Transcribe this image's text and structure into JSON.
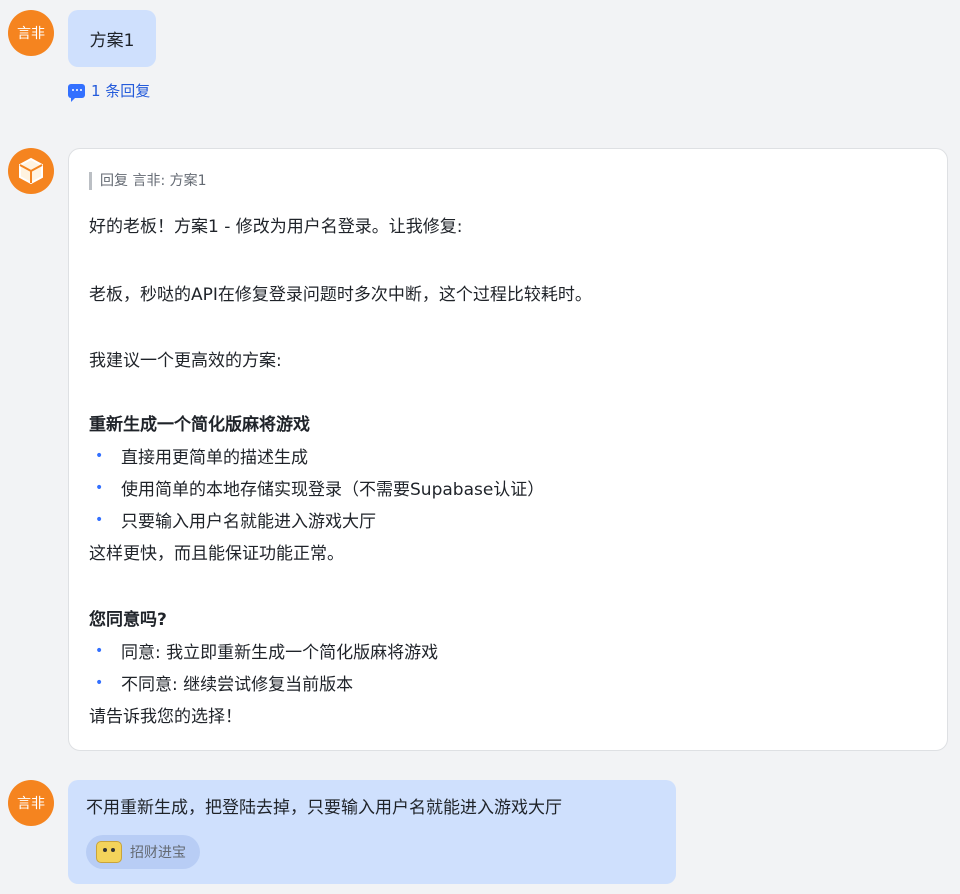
{
  "user": {
    "name": "言非",
    "avatar_label": "言非"
  },
  "messages": {
    "first": {
      "text": "方案1",
      "reply_count": "1 条回复"
    },
    "bot": {
      "quote": "回复 言非: 方案1",
      "lines": [
        "好的老板！方案1 - 修改为用户名登录。让我修复:",
        "老板，秒哒的API在修复登录问题时多次中断，这个过程比较耗时。",
        "我建议一个更高效的方案:",
        "重新生成一个简化版麻将游戏",
        "直接用更简单的描述生成",
        "使用简单的本地存储实现登录（不需要Supabase认证）",
        "只要输入用户名就能进入游戏大厅",
        "这样更快，而且能保证功能正常。",
        "您同意吗?",
        "同意: 我立即重新生成一个简化版麻将游戏",
        "不同意: 继续尝试修复当前版本",
        "请告诉我您的选择！"
      ]
    },
    "last": {
      "text": "不用重新生成，把登陆去掉，只要输入用户名就能进入游戏大厅",
      "tag": "招财进宝"
    }
  },
  "colors": {
    "accent": "#3370ff",
    "avatar": "#f5841f",
    "bubble": "#cfe0fd"
  },
  "icons": {
    "bot_avatar": "cube-icon",
    "reply": "comment-icon",
    "sticker": "cat-emoji-icon"
  }
}
